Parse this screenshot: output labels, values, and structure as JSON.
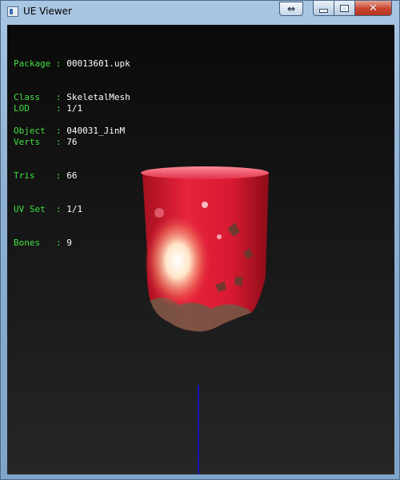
{
  "window": {
    "title": "UE Viewer",
    "buttons": {
      "extra_icon": "swap-arrows-icon",
      "minimize_icon": "minimize-icon",
      "maximize_icon": "maximize-icon",
      "close_icon": "close-icon"
    }
  },
  "info": {
    "package": {
      "label": "Package",
      "value": "00013601.upk"
    },
    "class": {
      "label": "Class  ",
      "value": "SkeletalMesh"
    },
    "object": {
      "label": "Object ",
      "value": "040031_JinM"
    },
    "lod": {
      "label": "LOD    ",
      "value": "1/1"
    },
    "verts": {
      "label": "Verts  ",
      "value": "76"
    },
    "tris": {
      "label": "Tris   ",
      "value": "66"
    },
    "uvset": {
      "label": "UV Set ",
      "value": "1/1"
    },
    "bones": {
      "label": "Bones  ",
      "value": "9"
    },
    "separator": ": "
  },
  "colors": {
    "label_green": "#40e040",
    "mesh_red": "#e0203a",
    "axis_blue": "#1515b8"
  }
}
